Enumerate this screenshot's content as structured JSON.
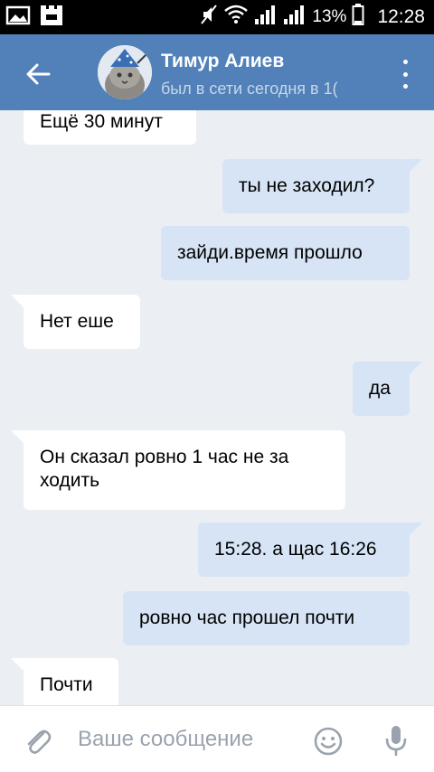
{
  "status_bar": {
    "battery": "13%",
    "time": "12:28",
    "icons": [
      "gallery-icon",
      "app-icon",
      "mute-icon",
      "wifi-icon",
      "signal-icon",
      "signal-icon",
      "battery-icon"
    ]
  },
  "header": {
    "name": "Тимур Алиев",
    "status": "был в сети сегодня в 1(",
    "colors": {
      "bar": "#5181b8",
      "status_text": "#c8d7ea"
    }
  },
  "messages": [
    {
      "direction": "in",
      "text": "Ещё 30 минут"
    },
    {
      "direction": "out",
      "text": "ты не заходил?"
    },
    {
      "direction": "out",
      "text": "зайди.время прошло"
    },
    {
      "direction": "in",
      "text": "Нет еше"
    },
    {
      "direction": "out",
      "text": "да"
    },
    {
      "direction": "in",
      "text": "Он сказал ровно 1 час не за ходить"
    },
    {
      "direction": "out",
      "text": "15:28. а щас 16:26"
    },
    {
      "direction": "out",
      "text": "ровно час прошел почти"
    },
    {
      "direction": "in",
      "text": "Почти"
    }
  ],
  "composer": {
    "placeholder": "Ваше сообщение"
  },
  "colors": {
    "background": "#ebeef2",
    "incoming_bubble": "#ffffff",
    "outgoing_bubble": "#d6e4f5"
  }
}
